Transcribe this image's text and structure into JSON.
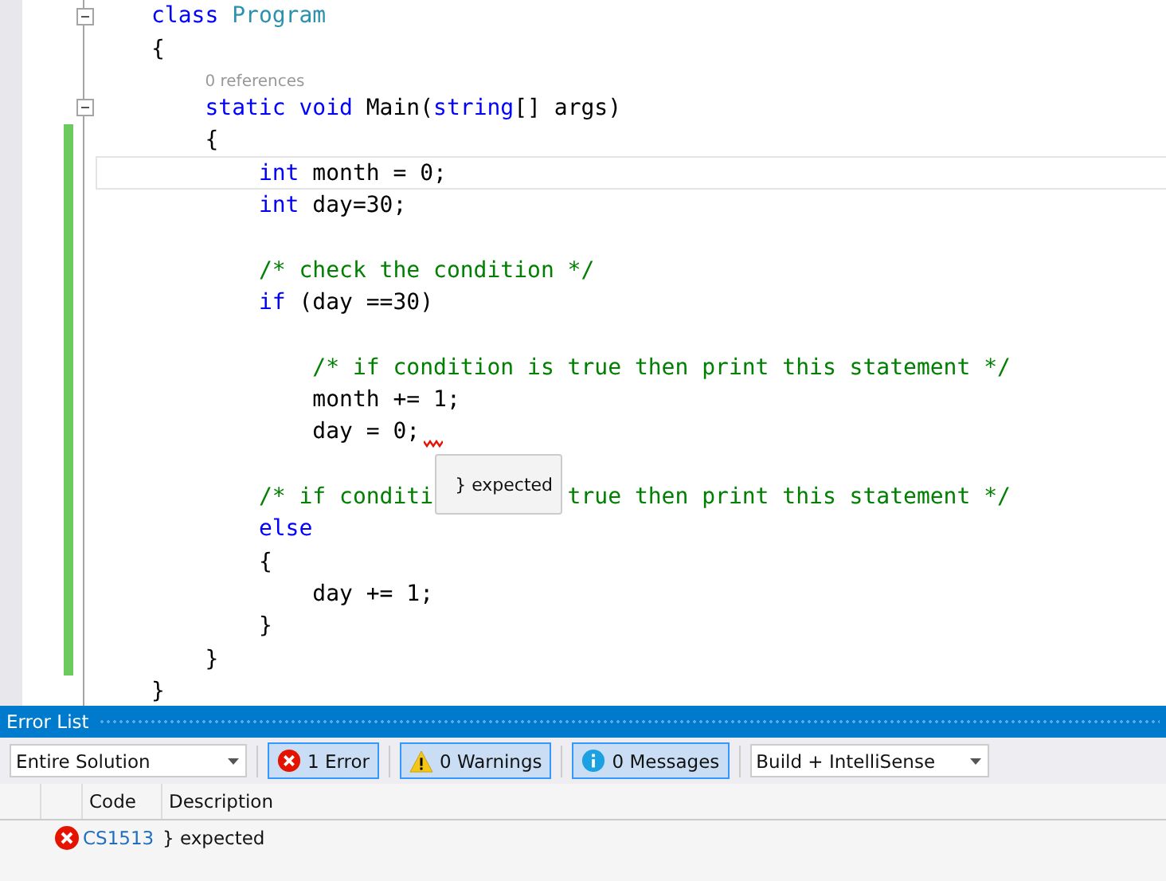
{
  "editor": {
    "lines": [
      {
        "kind": "code",
        "foldable": true,
        "changed": false,
        "current": false,
        "segments": [
          {
            "tokens": [
              {
                "kind": "keyword",
                "text": "class"
              },
              {
                "kind": "type",
                "text": " Program"
              }
            ]
          }
        ]
      },
      {
        "kind": "code",
        "foldable": false,
        "changed": false,
        "current": false,
        "segments": [
          {
            "tokens": [
              {
                "kind": "plain",
                "text": "{"
              }
            ]
          }
        ]
      },
      {
        "kind": "codelens",
        "text": "    0 references"
      },
      {
        "kind": "code",
        "foldable": true,
        "changed": false,
        "current": false,
        "segments": [
          {
            "tokens": [
              {
                "kind": "keyword",
                "text": "    static"
              },
              {
                "kind": "keyword",
                "text": " void"
              },
              {
                "kind": "plain",
                "text": " Main("
              },
              {
                "kind": "keyword",
                "text": "string"
              },
              {
                "kind": "plain",
                "text": "[] args)"
              }
            ]
          }
        ]
      },
      {
        "kind": "code",
        "foldable": false,
        "changed": true,
        "current": false,
        "segments": [
          {
            "tokens": [
              {
                "kind": "plain",
                "text": "    {"
              }
            ]
          }
        ]
      },
      {
        "kind": "code",
        "foldable": false,
        "changed": true,
        "current": true,
        "segments": [
          {
            "tokens": [
              {
                "kind": "keyword",
                "text": "        int"
              },
              {
                "kind": "plain",
                "text": " month = 0;"
              }
            ]
          }
        ]
      },
      {
        "kind": "code",
        "foldable": false,
        "changed": true,
        "current": false,
        "segments": [
          {
            "tokens": [
              {
                "kind": "keyword",
                "text": "        int"
              },
              {
                "kind": "plain",
                "text": " day=30;"
              }
            ]
          }
        ]
      },
      {
        "kind": "code",
        "foldable": false,
        "changed": true,
        "current": false
      },
      {
        "kind": "code",
        "foldable": false,
        "changed": true,
        "current": false,
        "segments": [
          {
            "tokens": [
              {
                "kind": "comment",
                "text": "        /* check the condition */"
              }
            ]
          }
        ]
      },
      {
        "kind": "code",
        "foldable": false,
        "changed": true,
        "current": false,
        "segments": [
          {
            "tokens": [
              {
                "kind": "keyword",
                "text": "        if"
              },
              {
                "kind": "plain",
                "text": " (day ==30)"
              }
            ]
          }
        ]
      },
      {
        "kind": "code",
        "foldable": false,
        "changed": true,
        "current": false
      },
      {
        "kind": "code",
        "foldable": false,
        "changed": true,
        "current": false,
        "segments": [
          {
            "tokens": [
              {
                "kind": "comment",
                "text": "            /* if condition is true then print this statement */"
              }
            ]
          }
        ]
      },
      {
        "kind": "code",
        "foldable": false,
        "changed": true,
        "current": false,
        "segments": [
          {
            "tokens": [
              {
                "kind": "plain",
                "text": "            month += 1;"
              }
            ]
          }
        ]
      },
      {
        "kind": "code",
        "foldable": false,
        "changed": true,
        "current": false,
        "segments": [
          {
            "tokens": [
              {
                "kind": "plain",
                "text": "            day = 0;"
              }
            ]
          }
        ],
        "error": {
          "message": "} expected"
        }
      },
      {
        "kind": "code",
        "foldable": false,
        "changed": true,
        "current": false
      },
      {
        "kind": "code",
        "foldable": false,
        "changed": true,
        "current": false,
        "segments": [
          {
            "tokens": [
              {
                "kind": "comment",
                "text": "        /* if conditi"
              }
            ]
          },
          {
            "tokens": [
              {
                "kind": "comment",
                "text": "true then print this statement */"
              }
            ]
          }
        ]
      },
      {
        "kind": "code",
        "foldable": false,
        "changed": true,
        "current": false,
        "segments": [
          {
            "tokens": [
              {
                "kind": "keyword",
                "text": "        else"
              }
            ]
          }
        ]
      },
      {
        "kind": "code",
        "foldable": false,
        "changed": true,
        "current": false,
        "segments": [
          {
            "tokens": [
              {
                "kind": "plain",
                "text": "        {"
              }
            ]
          }
        ]
      },
      {
        "kind": "code",
        "foldable": false,
        "changed": true,
        "current": false,
        "segments": [
          {
            "tokens": [
              {
                "kind": "plain",
                "text": "            day += 1;"
              }
            ]
          }
        ]
      },
      {
        "kind": "code",
        "foldable": false,
        "changed": true,
        "current": false,
        "segments": [
          {
            "tokens": [
              {
                "kind": "plain",
                "text": "        }"
              }
            ]
          }
        ]
      },
      {
        "kind": "code",
        "foldable": false,
        "changed": true,
        "current": false,
        "segments": [
          {
            "tokens": [
              {
                "kind": "plain",
                "text": "    }"
              }
            ]
          }
        ]
      },
      {
        "kind": "code",
        "foldable": false,
        "changed": false,
        "current": false,
        "segments": [
          {
            "tokens": [
              {
                "kind": "plain",
                "text": "}"
              }
            ]
          }
        ]
      }
    ]
  },
  "error_list": {
    "title": "Error List",
    "scope": "Entire Solution",
    "filters": [
      {
        "kind": "error",
        "label": "1 Error",
        "selected": true
      },
      {
        "kind": "warning",
        "label": "0 Warnings",
        "selected": true
      },
      {
        "kind": "info",
        "label": "0 Messages",
        "selected": true
      }
    ],
    "source": "Build + IntelliSense",
    "columns": [
      "Code",
      "Description"
    ],
    "rows": [
      {
        "kind": "error",
        "code": "CS1513",
        "description": "} expected"
      }
    ]
  }
}
